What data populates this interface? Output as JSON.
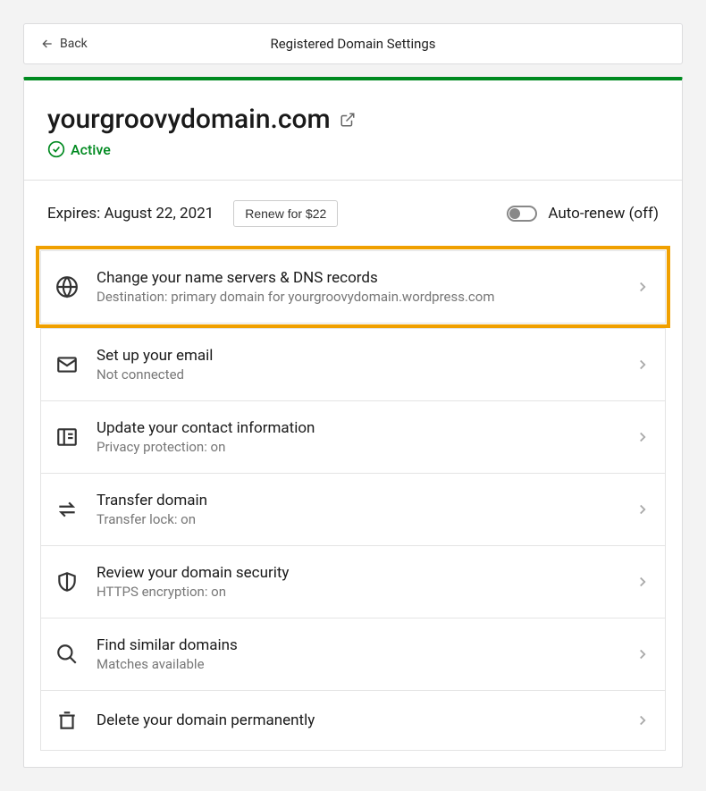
{
  "header": {
    "back_label": "Back",
    "title": "Registered Domain Settings"
  },
  "domain": {
    "name": "yourgroovydomain.com",
    "status": "Active"
  },
  "expiry": {
    "text": "Expires: August 22, 2021",
    "renew_label": "Renew for $22",
    "autorenew_label": "Auto-renew (off)"
  },
  "items": [
    {
      "title": "Change your name servers & DNS records",
      "sub": "Destination: primary domain for yourgroovydomain.wordpress.com"
    },
    {
      "title": "Set up your email",
      "sub": "Not connected"
    },
    {
      "title": "Update your contact information",
      "sub": "Privacy protection: on"
    },
    {
      "title": "Transfer domain",
      "sub": "Transfer lock: on"
    },
    {
      "title": "Review your domain security",
      "sub": "HTTPS encryption: on"
    },
    {
      "title": "Find similar domains",
      "sub": "Matches available"
    },
    {
      "title": "Delete your domain permanently",
      "sub": ""
    }
  ]
}
